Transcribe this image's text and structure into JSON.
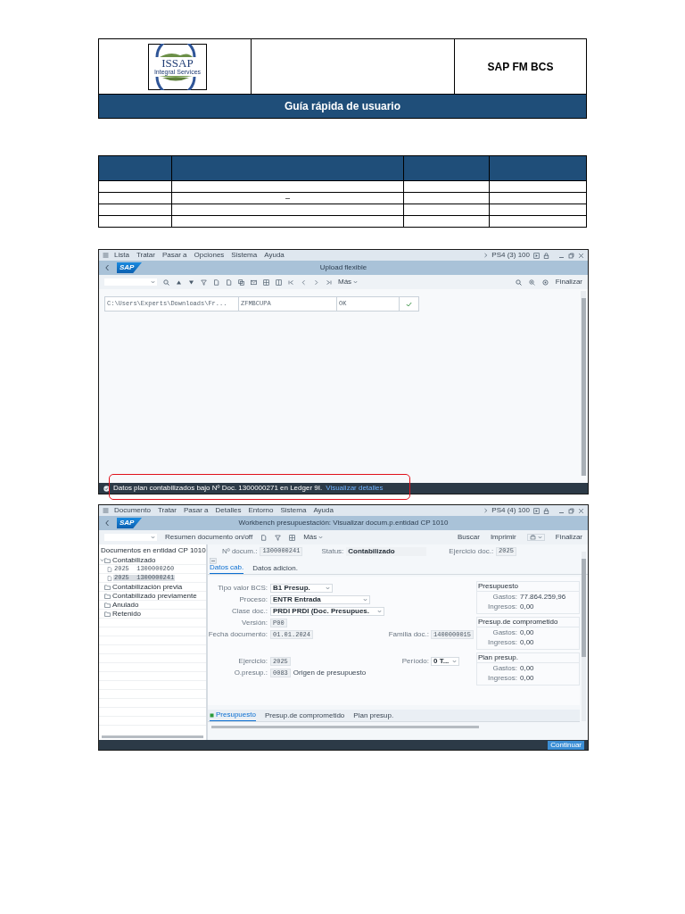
{
  "doc_header": {
    "logo_title": "ISSAP",
    "logo_subtitle": "Integral Services",
    "product": "SAP FM BCS",
    "guide_title": "Guía rápida de usuario"
  },
  "revision_table": {
    "cell_text": "–"
  },
  "upload_screen": {
    "menu": [
      "Lista",
      "Tratar",
      "Pasar a",
      "Opciones",
      "Sistema",
      "Ayuda"
    ],
    "system": "PS4 (3) 100",
    "logo": "SAP",
    "title": "Upload flexible",
    "toolbar": {
      "more": "Más",
      "finish": "Finalizar"
    },
    "result_row": {
      "file": "C:\\Users\\Experts\\Downloads\\Fr...",
      "program": "ZFMBCUPA",
      "status": "OK",
      "success": true
    },
    "status_bar": {
      "message": "Datos plan contabilizados bajo Nº Doc. 1300000271 en Ledger 9I.",
      "link": "Visualizar detalles"
    }
  },
  "workbench_screen": {
    "menu": [
      "Documento",
      "Tratar",
      "Pasar a",
      "Detalles",
      "Entorno",
      "Sistema",
      "Ayuda"
    ],
    "system": "PS4 (4) 100",
    "logo": "SAP",
    "title": "Workbench presupuestación: Visualizar docum.p.entidad CP 1010",
    "toolbar": {
      "toggle": "Resumen documento on/off",
      "more": "Más",
      "actions": [
        "Buscar",
        "Imprimir"
      ],
      "finish": "Finalizar"
    },
    "tree": {
      "title": "Documentos en entidad CP 1010",
      "items": [
        {
          "label": "Contabilizado",
          "expanded": true,
          "selected": false,
          "children": [
            {
              "label": "2025  1300000260",
              "selected": false
            },
            {
              "label": "2025  1300000241",
              "selected": true
            }
          ]
        },
        {
          "label": "Contabilización previa",
          "expanded": false,
          "selected": false
        },
        {
          "label": "Contabilizado previamente",
          "expanded": false,
          "selected": false
        },
        {
          "label": "Anulado",
          "expanded": false,
          "selected": false
        },
        {
          "label": "Retenido",
          "expanded": false,
          "selected": false
        }
      ]
    },
    "header_fields": [
      {
        "label": "Nº docum.:",
        "value": "1300000241",
        "kind": "readonly"
      },
      {
        "label": "Status:",
        "value": "Contabilizado",
        "kind": "text"
      },
      {
        "label": "Ejercicio doc.:",
        "value": "2025",
        "kind": "readonly"
      }
    ],
    "tabs": [
      {
        "label": "Datos cab.",
        "selected": true
      },
      {
        "label": "Datos adicion.",
        "selected": false
      }
    ],
    "form_rows": [
      {
        "left": {
          "label": "Tipo valor BCS:",
          "value": "B1 Presup.",
          "kind": "dropdown"
        }
      },
      {
        "left": {
          "label": "Proceso:",
          "value": "ENTR Entrada",
          "kind": "dropdown"
        }
      },
      {
        "left": {
          "label": "Clase doc.:",
          "value": "PRDI PRDI (Doc. Presupues.",
          "kind": "dropdown"
        }
      },
      {
        "left": {
          "label": "Versión:",
          "value": "P00",
          "kind": "readonly"
        }
      },
      {
        "left": {
          "label": "Fecha documento:",
          "value": "01.01.2024",
          "kind": "readonly"
        },
        "right": {
          "label": "Familia doc.:",
          "value": "1400000015",
          "kind": "readonly"
        }
      },
      {
        "left": {
          "label": "Ejercicio:",
          "value": "2025",
          "kind": "readonly"
        },
        "right": {
          "label": "Período:",
          "value": "0 T...",
          "kind": "dropdown"
        }
      },
      {
        "left": {
          "label": "O.presup.:",
          "value": "0083",
          "kind": "readonly"
        },
        "note": "Origen de presupuesto"
      }
    ],
    "summary": [
      {
        "title": "Presupuesto",
        "lines": [
          {
            "label": "Gastos:",
            "value": "77.864.259,96"
          },
          {
            "label": "Ingresos:",
            "value": "0,00"
          }
        ]
      },
      {
        "title": "Presup.de comprometido",
        "lines": [
          {
            "label": "Gastos:",
            "value": "0,00"
          },
          {
            "label": "Ingresos:",
            "value": "0,00"
          }
        ]
      },
      {
        "title": "Plan presup.",
        "lines": [
          {
            "label": "Gastos:",
            "value": "0,00"
          },
          {
            "label": "Ingresos:",
            "value": "0,00"
          }
        ]
      }
    ],
    "bottom_tabs": [
      {
        "label": "Presupuesto",
        "selected": true
      },
      {
        "label": "Presup.de comprometido",
        "selected": false
      },
      {
        "label": "Plan presup.",
        "selected": false
      }
    ],
    "footer_button": "Continuar"
  }
}
